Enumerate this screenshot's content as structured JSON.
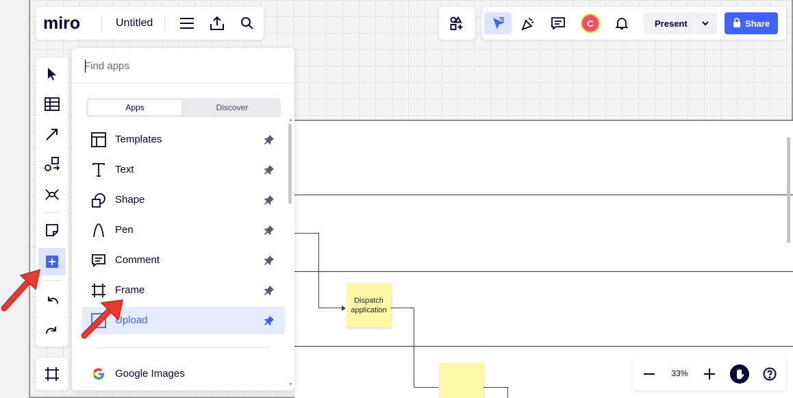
{
  "app": {
    "logo": "miro",
    "board_title": "Untitled"
  },
  "header": {
    "present_label": "Present",
    "share_label": "Share",
    "avatar_initial": "C"
  },
  "apps_panel": {
    "search_placeholder": "Find apps",
    "tabs": [
      {
        "label": "Apps",
        "active": true
      },
      {
        "label": "Discover",
        "active": false
      }
    ],
    "items": [
      {
        "label": "Templates",
        "icon": "templates-icon"
      },
      {
        "label": "Text",
        "icon": "text-icon"
      },
      {
        "label": "Shape",
        "icon": "shape-icon"
      },
      {
        "label": "Pen",
        "icon": "pen-icon"
      },
      {
        "label": "Comment",
        "icon": "comment-icon"
      },
      {
        "label": "Frame",
        "icon": "frame-icon"
      },
      {
        "label": "Upload",
        "icon": "upload-icon",
        "active": true
      }
    ],
    "extra_items": [
      {
        "label": "Google Images",
        "icon": "google-icon"
      }
    ]
  },
  "canvas": {
    "sticky_notes": [
      {
        "text": "Dispatch application"
      },
      {
        "text": ""
      }
    ]
  },
  "zoom": {
    "level": "33%"
  },
  "colors": {
    "accent": "#4262ff",
    "sticky": "#fff8a6",
    "annotation_arrow": "#e83a2e"
  }
}
